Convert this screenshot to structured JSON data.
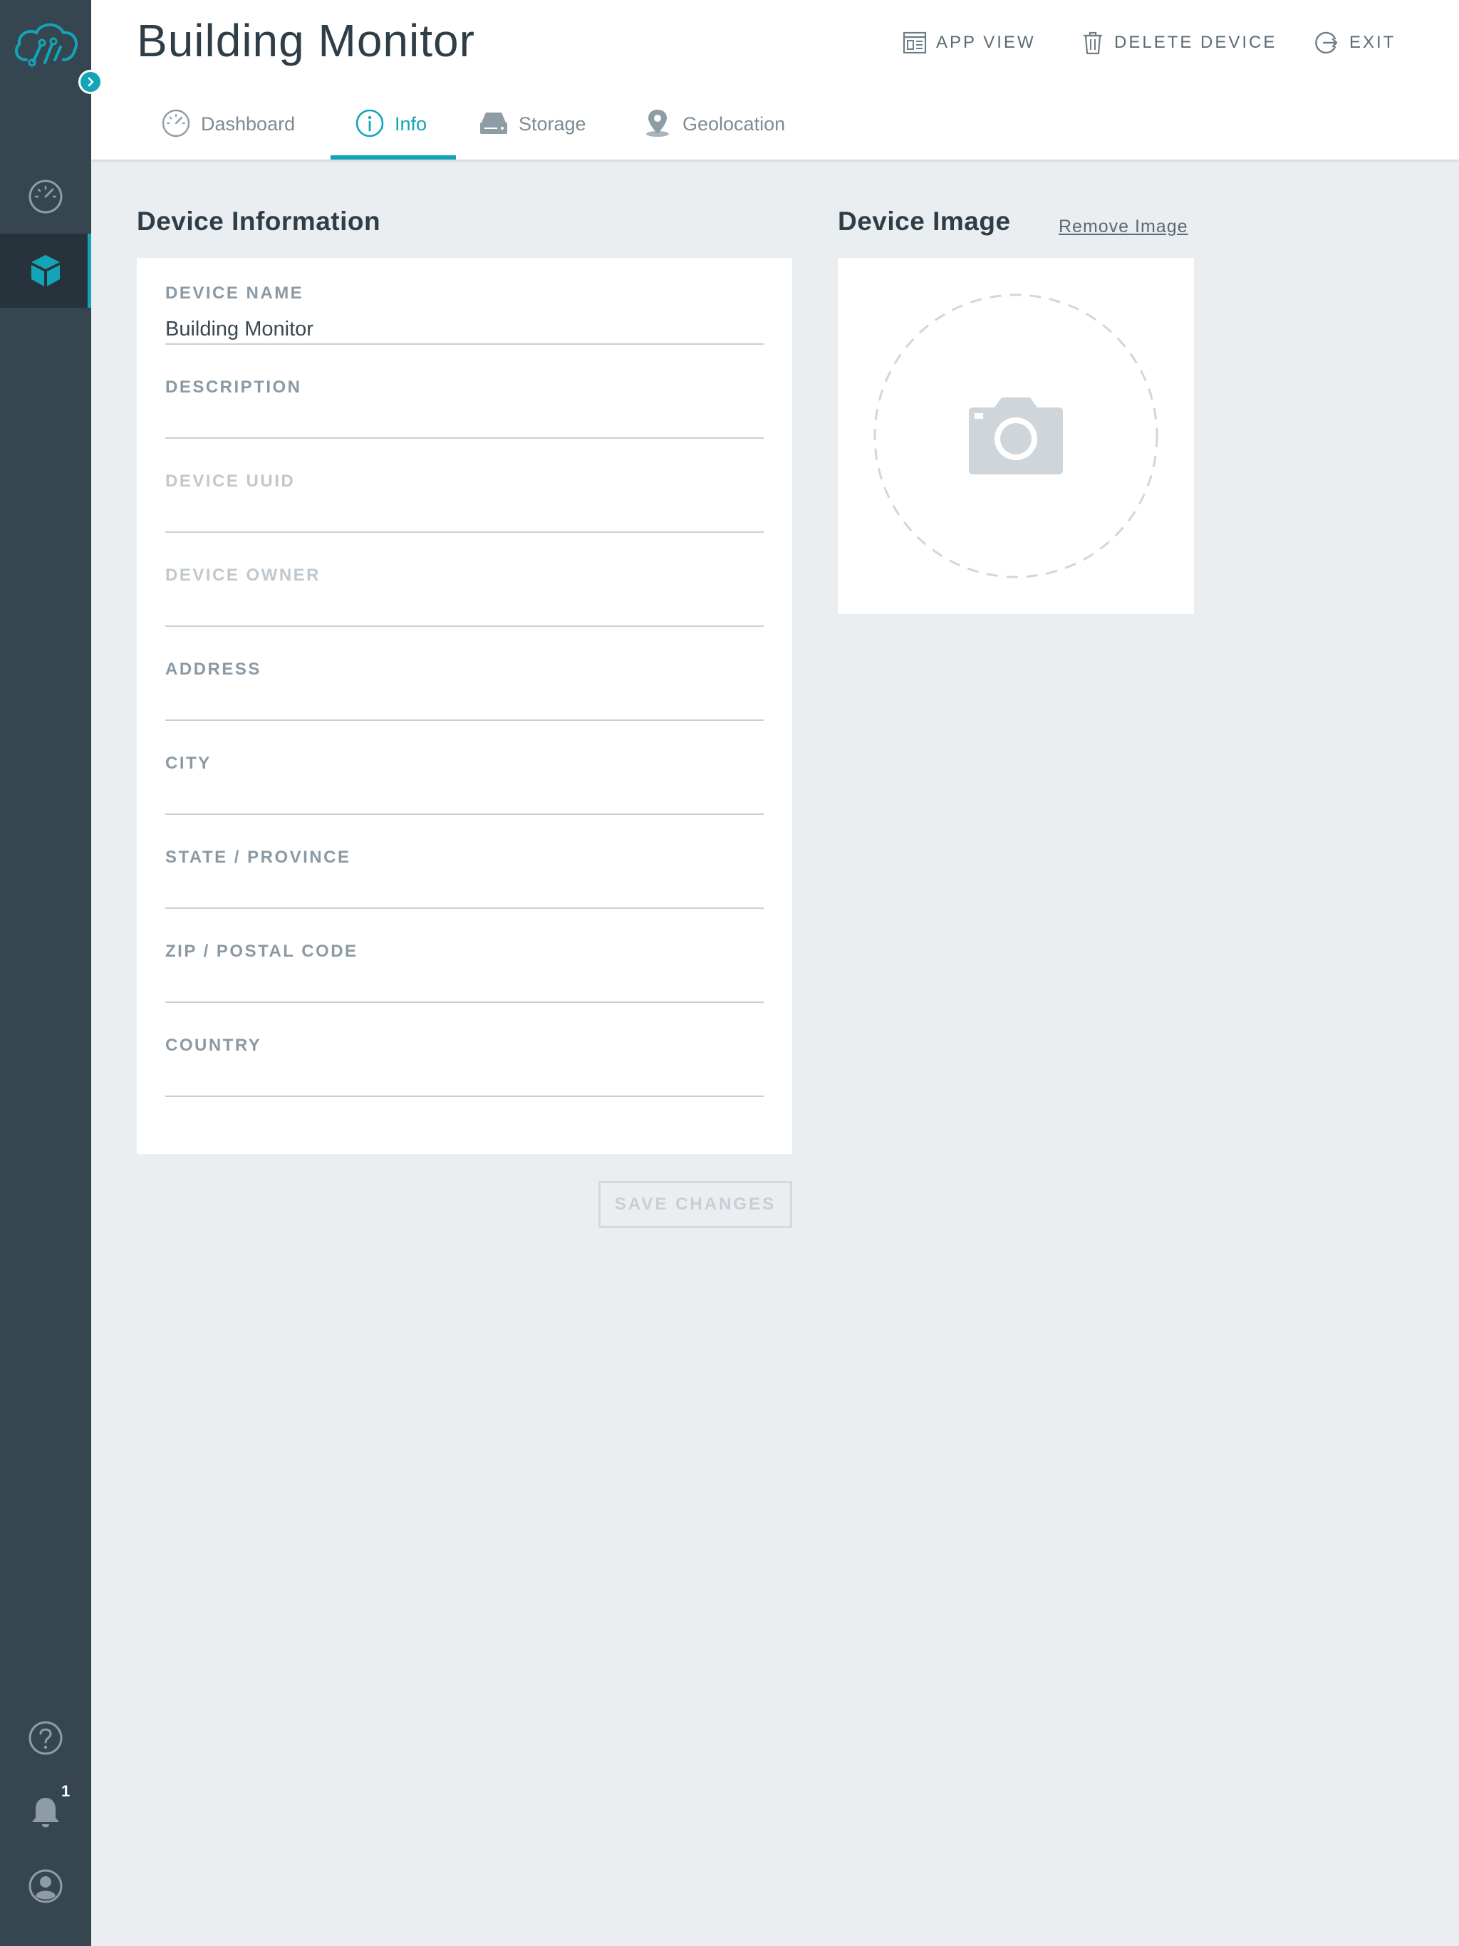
{
  "header": {
    "title": "Building Monitor",
    "actions": [
      {
        "label": "APP VIEW",
        "icon": "app-view-icon"
      },
      {
        "label": "DELETE DEVICE",
        "icon": "trash-icon"
      },
      {
        "label": "EXIT",
        "icon": "exit-icon"
      }
    ]
  },
  "tabs": [
    {
      "label": "Dashboard",
      "icon": "gauge-icon",
      "active": false
    },
    {
      "label": "Info",
      "icon": "info-icon",
      "active": true
    },
    {
      "label": "Storage",
      "icon": "storage-icon",
      "active": false
    },
    {
      "label": "Geolocation",
      "icon": "map-pin-icon",
      "active": false
    }
  ],
  "sidebar": {
    "items": [
      {
        "icon": "gauge-icon",
        "active": false
      },
      {
        "icon": "cube-icon",
        "active": true
      }
    ],
    "bottom": [
      {
        "icon": "help-icon"
      },
      {
        "icon": "bell-icon",
        "badge": "1"
      },
      {
        "icon": "user-icon"
      }
    ]
  },
  "device_info": {
    "title": "Device Information",
    "fields": [
      {
        "label": "DEVICE NAME",
        "value": "Building Monitor",
        "disabled": false
      },
      {
        "label": "DESCRIPTION",
        "value": "",
        "disabled": false
      },
      {
        "label": "DEVICE UUID",
        "value": "",
        "disabled": true
      },
      {
        "label": "DEVICE OWNER",
        "value": "",
        "disabled": true
      },
      {
        "label": "ADDRESS",
        "value": "",
        "disabled": false
      },
      {
        "label": "CITY",
        "value": "",
        "disabled": false
      },
      {
        "label": "STATE / PROVINCE",
        "value": "",
        "disabled": false
      },
      {
        "label": "ZIP / POSTAL CODE",
        "value": "",
        "disabled": false
      },
      {
        "label": "COUNTRY",
        "value": "",
        "disabled": false
      }
    ],
    "save_label": "SAVE CHANGES"
  },
  "device_image": {
    "title": "Device Image",
    "remove_label": "Remove Image"
  },
  "colors": {
    "accent": "#13a4b8",
    "sidebar": "#364650",
    "background": "#eaeef1"
  }
}
